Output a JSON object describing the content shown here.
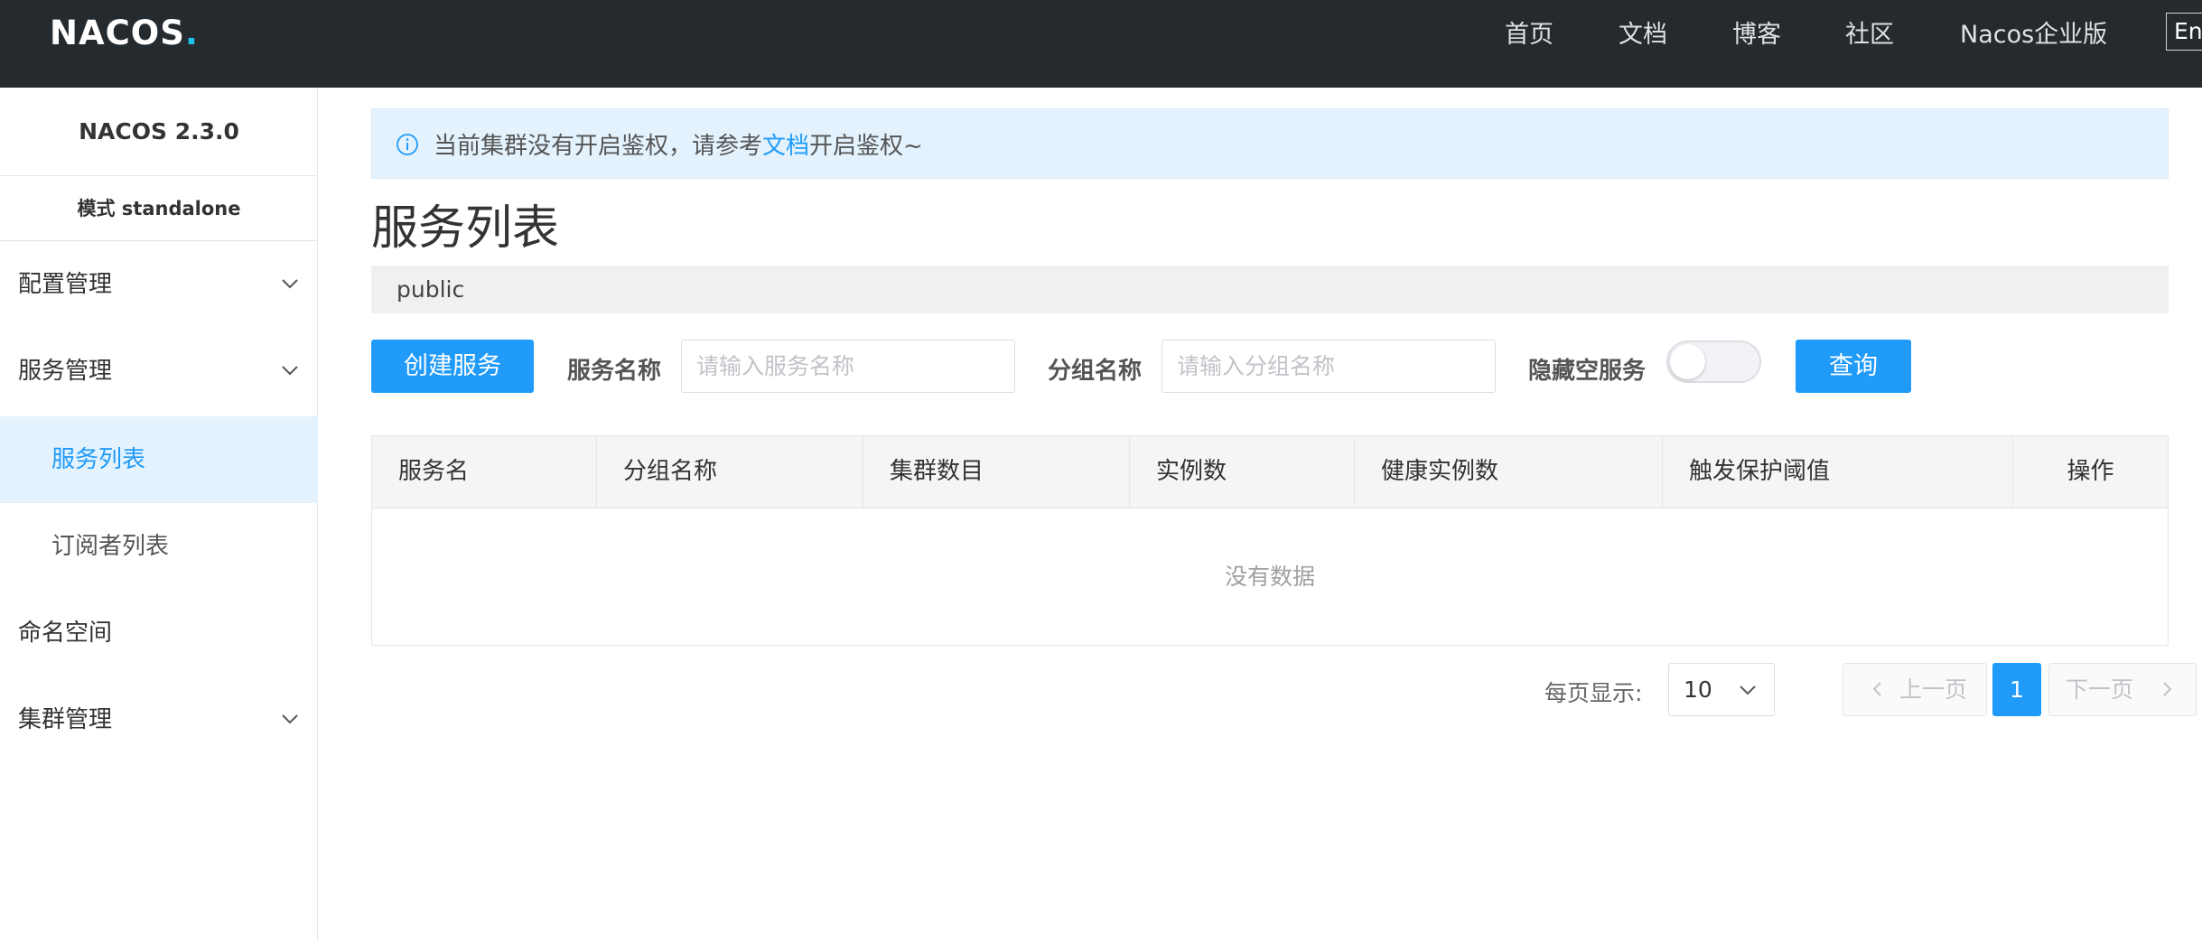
{
  "header": {
    "logo_text": "NACOS",
    "nav": [
      "首页",
      "文档",
      "博客",
      "社区",
      "Nacos企业版"
    ],
    "lang_button": "En"
  },
  "sidebar": {
    "version": "NACOS 2.3.0",
    "mode": "模式 standalone",
    "items": [
      {
        "label": "配置管理",
        "expandable": true
      },
      {
        "label": "服务管理",
        "expandable": true
      },
      {
        "label": "服务列表",
        "active": true
      },
      {
        "label": "订阅者列表"
      },
      {
        "label": "命名空间"
      },
      {
        "label": "集群管理",
        "expandable": true
      }
    ]
  },
  "notice": {
    "prefix": "当前集群没有开启鉴权，请参考",
    "link": "文档",
    "suffix": "开启鉴权~"
  },
  "page": {
    "title": "服务列表",
    "namespace": "public"
  },
  "filters": {
    "create_button": "创建服务",
    "service_name_label": "服务名称",
    "service_name_placeholder": "请输入服务名称",
    "group_name_label": "分组名称",
    "group_name_placeholder": "请输入分组名称",
    "hide_empty_label": "隐藏空服务",
    "hide_empty_on": false,
    "query_button": "查询"
  },
  "table": {
    "columns": [
      "服务名",
      "分组名称",
      "集群数目",
      "实例数",
      "健康实例数",
      "触发保护阈值",
      "操作"
    ],
    "empty_text": "没有数据"
  },
  "pagination": {
    "page_size_label": "每页显示:",
    "page_size": "10",
    "prev": "上一页",
    "current_page": "1",
    "next": "下一页"
  },
  "colors": {
    "topbar": "#252a2f",
    "primary": "#209bfa",
    "notice_bg": "#e3f2fd"
  }
}
